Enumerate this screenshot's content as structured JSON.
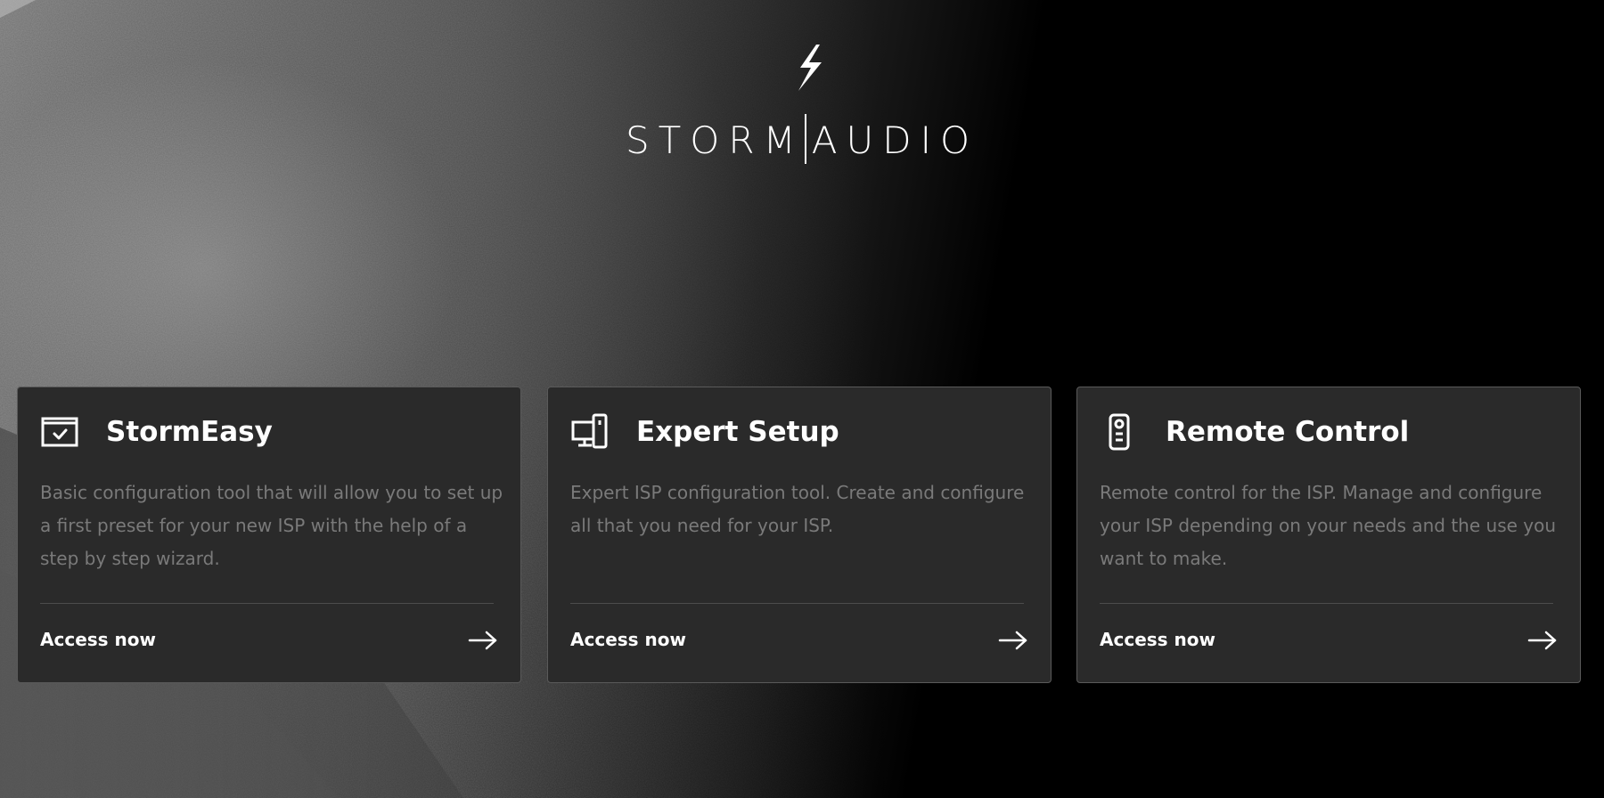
{
  "brand": {
    "logo_icon": "lightning-bolt-icon",
    "name_left": "STORM",
    "name_right": "AUDIO"
  },
  "cards": [
    {
      "icon": "screen-check-icon",
      "title": "StormEasy",
      "description": "Basic configuration tool that will allow you to set up a first preset for your new ISP with the help of a step by step wizard.",
      "link_label": "Access now",
      "link_icon": "arrow-right-icon"
    },
    {
      "icon": "monitor-device-icon",
      "title": "Expert Setup",
      "description": "Expert ISP configuration tool. Create and configure all that you need for your ISP.",
      "link_label": "Access now",
      "link_icon": "arrow-right-icon"
    },
    {
      "icon": "remote-control-icon",
      "title": "Remote Control",
      "description": "Remote control for the ISP. Manage and configure your ISP depending on your needs and the use you want to make.",
      "link_label": "Access now",
      "link_icon": "arrow-right-icon"
    }
  ],
  "colors": {
    "card_bg": "#2a2a2a",
    "card_border": "#5a5a5a",
    "title_text": "#ffffff",
    "description_text": "#7a7a7a"
  }
}
